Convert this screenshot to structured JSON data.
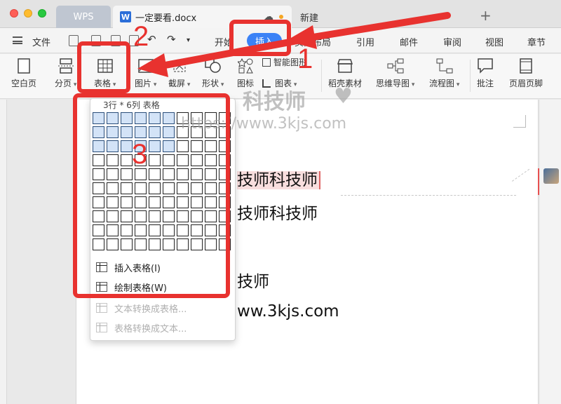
{
  "titlebar": {
    "wps_tab": "WPS",
    "doc_icon_letter": "W",
    "doc_tab": "一定要看.docx",
    "new_tab": "新建",
    "plus": "+"
  },
  "menubar": {
    "file": "文件",
    "start": "开始",
    "insert": "插入",
    "page_layout": "页面布局",
    "references": "引用",
    "mail": "邮件",
    "review": "审阅",
    "view": "视图",
    "chapter": "章节"
  },
  "ribbon": {
    "blank_page": "空白页",
    "page_break": "分页",
    "table": "表格",
    "picture": "图片",
    "screenshot": "截屏",
    "shapes": "形状",
    "icons": "图标",
    "smart_shape": "智能图形",
    "chart": "图表",
    "daoke_material": "稻壳素材",
    "mind_map": "思维导图",
    "flowchart": "流程图",
    "comment": "批注",
    "header_footer": "页眉页脚"
  },
  "document": {
    "line1": "技师科技师",
    "line2": "技师科技师",
    "line3": "技师",
    "line4": "ww.3kjs.com"
  },
  "dropdown": {
    "grid_label": "3行 * 6列 表格",
    "grid_rows": 10,
    "grid_cols": 10,
    "selected_rows": 3,
    "selected_cols": 6,
    "items": [
      {
        "label": "插入表格(I)",
        "enabled": true
      },
      {
        "label": "绘制表格(W)",
        "enabled": true
      },
      {
        "label": "文本转换成表格...",
        "enabled": false
      },
      {
        "label": "表格转换成文本...",
        "enabled": false
      }
    ]
  },
  "annotations": {
    "step1": "1",
    "step2": "2",
    "step3": "3",
    "color": "#e8322f"
  },
  "watermark": {
    "brand": "科技师",
    "url": "https://www.3kjs.com"
  },
  "colors": {
    "accent": "#3b82f6",
    "selected_cell": "#d3e3f7",
    "annotation_red": "#e8322f"
  }
}
